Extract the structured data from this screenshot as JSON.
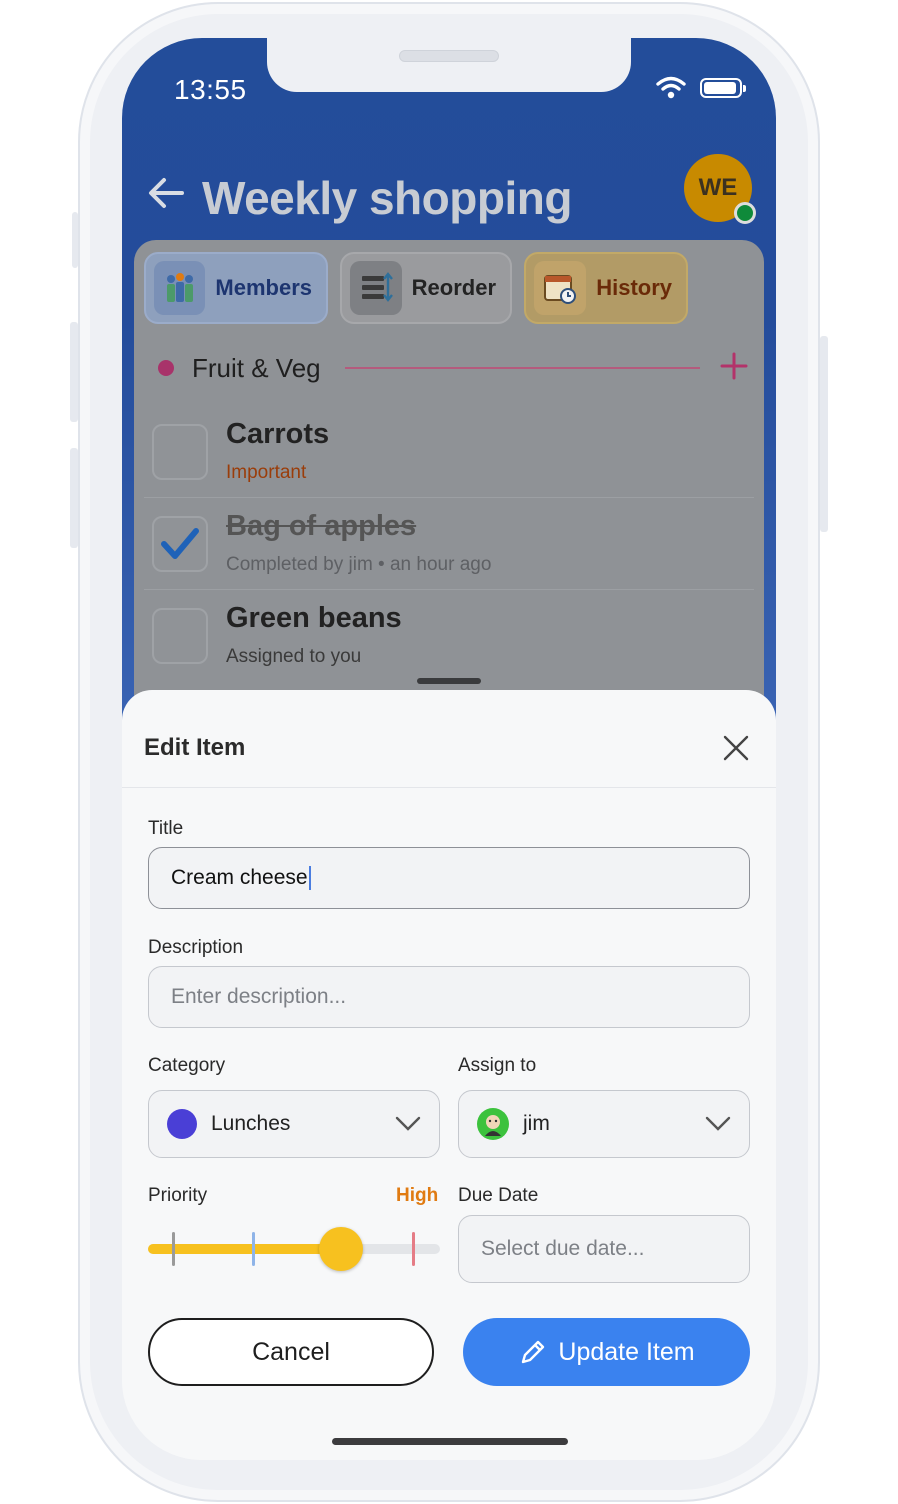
{
  "status_bar": {
    "time": "13:55"
  },
  "header": {
    "title": "Weekly shopping",
    "avatar_initials": "WE"
  },
  "tabs": [
    {
      "label": "Members"
    },
    {
      "label": "Reorder"
    },
    {
      "label": "History"
    }
  ],
  "section": {
    "label": "Fruit & Veg"
  },
  "items": [
    {
      "title": "Carrots",
      "subtitle": "Important",
      "checked": false
    },
    {
      "title": "Bag of apples",
      "subtitle": "Completed by jim • an hour ago",
      "checked": true
    },
    {
      "title": "Green beans",
      "subtitle": "Assigned to you",
      "checked": false
    }
  ],
  "sheet": {
    "title": "Edit Item",
    "title_label": "Title",
    "title_value": "Cream cheese",
    "description_label": "Description",
    "description_placeholder": "Enter description...",
    "category_label": "Category",
    "category_value": "Lunches",
    "category_color": "#4a3fd6",
    "assign_label": "Assign to",
    "assign_value": "jim",
    "priority_label": "Priority",
    "priority_value": "High",
    "priority_level": 0.66,
    "due_label": "Due Date",
    "due_placeholder": "Select due date...",
    "cancel_label": "Cancel",
    "update_label": "Update Item"
  },
  "colors": {
    "header_blue": "#234d9a",
    "accent_blue": "#3a82ef",
    "priority_yellow": "#f7c11f",
    "high_orange": "#e07b12"
  }
}
